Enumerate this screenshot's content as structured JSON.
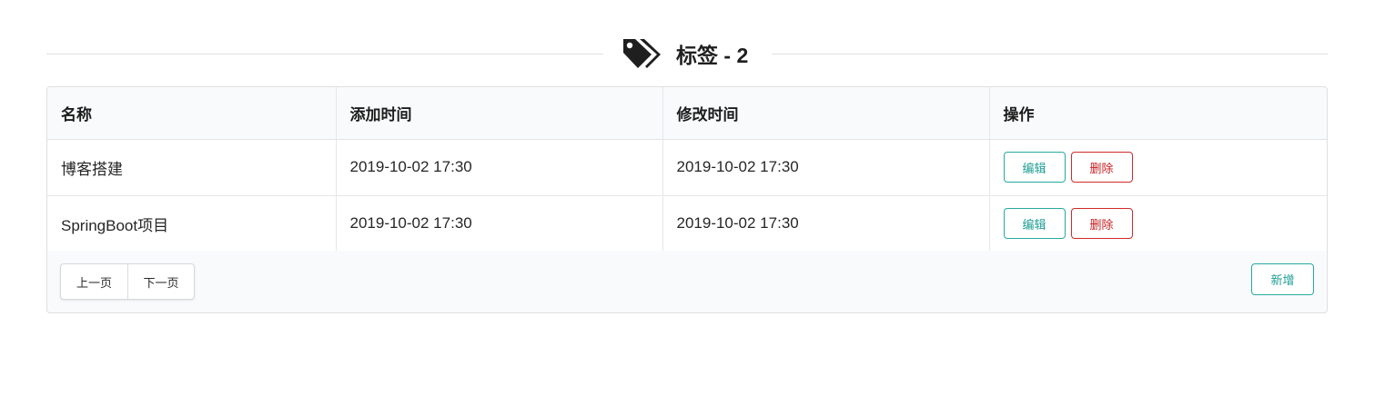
{
  "header": {
    "icon": "tags-icon",
    "title": "标签 - 2"
  },
  "table": {
    "columns": [
      "名称",
      "添加时间",
      "修改时间",
      "操作"
    ],
    "rows": [
      {
        "name": "博客搭建",
        "created": "2019-10-02 17:30",
        "modified": "2019-10-02 17:30",
        "edit_label": "编辑",
        "delete_label": "删除"
      },
      {
        "name": "SpringBoot项目",
        "created": "2019-10-02 17:30",
        "modified": "2019-10-02 17:30",
        "edit_label": "编辑",
        "delete_label": "删除"
      }
    ]
  },
  "footer": {
    "prev_label": "上一页",
    "next_label": "下一页",
    "add_label": "新增"
  },
  "colors": {
    "accent_teal": "#1e9e96",
    "danger_red": "#c92020"
  }
}
